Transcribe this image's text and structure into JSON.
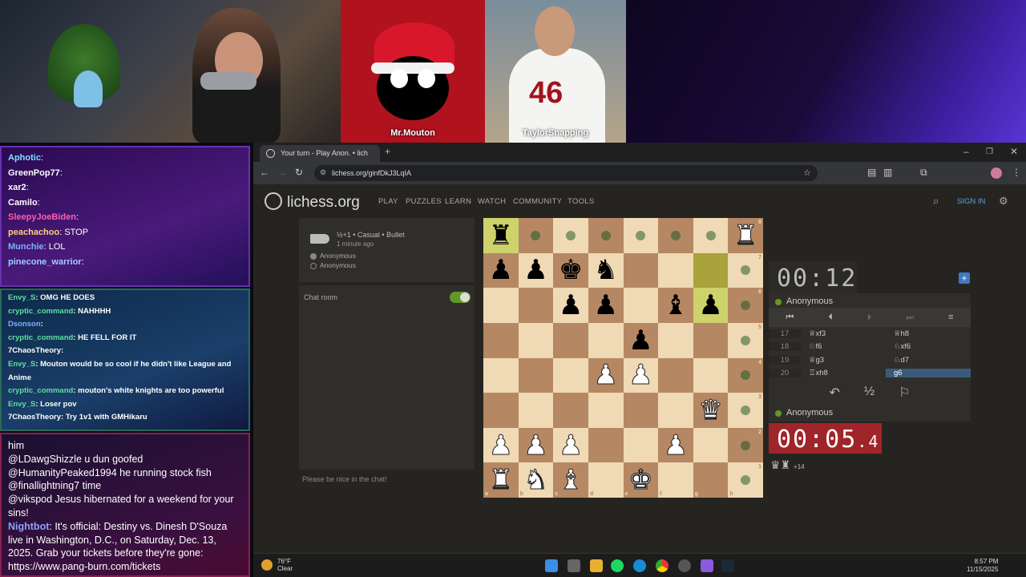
{
  "stream": {
    "tile1_name": "Mr.Mouton",
    "tile2_name": "TaylorSnapping",
    "tile2_jersey": "46"
  },
  "chat1": [
    {
      "user": "Aphotic",
      "color": "#7fe0ff",
      "msg": ""
    },
    {
      "user": "GreenPop77",
      "color": "#ffffff",
      "msg": ""
    },
    {
      "user": "xar2",
      "color": "#ffffff",
      "msg": ""
    },
    {
      "user": "Camilo",
      "color": "#ffffff",
      "msg": ""
    },
    {
      "user": "SleepyJoeBiden",
      "color": "#ff5fb0",
      "msg": ""
    },
    {
      "user": "peachachoo",
      "color": "#ffd080",
      "msg": "STOP"
    },
    {
      "user": "Munchie",
      "color": "#7fb0ff",
      "msg": "LOL"
    },
    {
      "user": "pinecone_warrior",
      "color": "#9fd0ff",
      "msg": ""
    }
  ],
  "chat2": [
    {
      "user": "Envy_S",
      "color": "#5fe0a0",
      "msg": "OMG HE DOES"
    },
    {
      "user": "cryptic_command",
      "color": "#5fe0a0",
      "msg": "NAHHHH"
    },
    {
      "user": "Dsonson",
      "color": "#7fb0ff",
      "msg": ""
    },
    {
      "user": "cryptic_command",
      "color": "#5fe0a0",
      "msg": "HE FELL FOR IT"
    },
    {
      "user": "7ChaosTheory",
      "color": "#ffffff",
      "msg": ""
    },
    {
      "user": "Envy_S",
      "color": "#5fe0a0",
      "msg": "Mouton would be so cool if he didn't like League and Anime"
    },
    {
      "user": "cryptic_command",
      "color": "#5fe0a0",
      "msg": "mouton's white knights are too powerful"
    },
    {
      "user": "Envy_S",
      "color": "#5fe0a0",
      "msg": "Loser pov"
    },
    {
      "user": "7ChaosTheory",
      "color": "#ffffff",
      "msg": "Try 1v1 with GMHikaru"
    }
  ],
  "chat3": [
    {
      "user": "",
      "color": "#ffffff",
      "msg": "him"
    },
    {
      "user": "",
      "color": "#ffffff",
      "msg": "@LDawgShizzle u dun goofed"
    },
    {
      "user": "",
      "color": "#ffffff",
      "msg": "@HumanityPeaked1994 he running stock fish"
    },
    {
      "user": "",
      "color": "#ffffff",
      "msg": "@finallightning7 time"
    },
    {
      "user": "",
      "color": "#ffffff",
      "msg": "@vikspod Jesus hibernated for a weekend for your sins!"
    },
    {
      "user": "Nightbot",
      "color": "#8fa0ff",
      "msg": "It's official: Destiny vs. Dinesh D'Souza live in Washington, D.C., on Saturday, Dec. 13, 2025. Grab your tickets before they're gone: https://www.pang-burn.com/tickets"
    }
  ],
  "browser": {
    "tab_title": "Your turn - Play Anon. • lich",
    "url": "lichess.org/ginfDkJ3LqIA"
  },
  "site": {
    "logo": "lichess.org",
    "nav": [
      "PLAY",
      "PUZZLES",
      "LEARN",
      "WATCH",
      "COMMUNITY",
      "TOOLS"
    ],
    "sign_in": "SIGN IN"
  },
  "game": {
    "mode": "½+1 • Casual • Bullet",
    "time_ago": "1 minute ago",
    "player1": "Anonymous",
    "player2": "Anonymous",
    "chat_label": "Chat room",
    "chat_placeholder": "Please be nice in the chat!"
  },
  "board": {
    "files": [
      "a",
      "b",
      "c",
      "d",
      "e",
      "f",
      "g",
      "h"
    ],
    "ranks": [
      "8",
      "7",
      "6",
      "5",
      "4",
      "3",
      "2",
      "1"
    ],
    "position": [
      [
        "r",
        "",
        "",
        "",
        "",
        "",
        "",
        "R"
      ],
      [
        "p",
        "p",
        "k",
        "n",
        "",
        "",
        "",
        ""
      ],
      [
        "",
        "",
        "p",
        "p",
        "",
        "b",
        "p",
        ""
      ],
      [
        "",
        "",
        "",
        "",
        "p",
        "",
        "",
        ""
      ],
      [
        "",
        "",
        "",
        "P",
        "P",
        "",
        "",
        ""
      ],
      [
        "",
        "",
        "",
        "",
        "",
        "",
        "Q",
        ""
      ],
      [
        "P",
        "P",
        "P",
        "",
        "",
        "P",
        "",
        ""
      ],
      [
        "R",
        "N",
        "B",
        "",
        "K",
        "",
        "",
        ""
      ]
    ],
    "highlights": [
      [
        0,
        0
      ],
      [
        1,
        6
      ],
      [
        2,
        6
      ]
    ],
    "dots": [
      [
        0,
        1
      ],
      [
        0,
        2
      ],
      [
        0,
        3
      ],
      [
        0,
        4
      ],
      [
        0,
        5
      ],
      [
        0,
        6
      ],
      [
        1,
        7
      ],
      [
        2,
        7
      ],
      [
        3,
        7
      ],
      [
        4,
        7
      ],
      [
        5,
        7
      ],
      [
        6,
        7
      ],
      [
        7,
        7
      ]
    ]
  },
  "clocks": {
    "top": "00:12",
    "bottom_main": "00:05",
    "bottom_tenths": ".4",
    "top_player": "Anonymous",
    "bottom_player": "Anonymous",
    "material_diff": "+14"
  },
  "moves": [
    {
      "n": "17",
      "w": "♕xf3",
      "b": "♕h8"
    },
    {
      "n": "18",
      "w": "♘f6",
      "b": "♘xf6"
    },
    {
      "n": "19",
      "w": "♕g3",
      "b": "♘d7"
    },
    {
      "n": "20",
      "w": "♖xh8",
      "b": "g6"
    }
  ],
  "taskbar": {
    "temp": "76°F",
    "weather": "Clear",
    "time": "8:57 PM",
    "date": "11/15/2025"
  }
}
